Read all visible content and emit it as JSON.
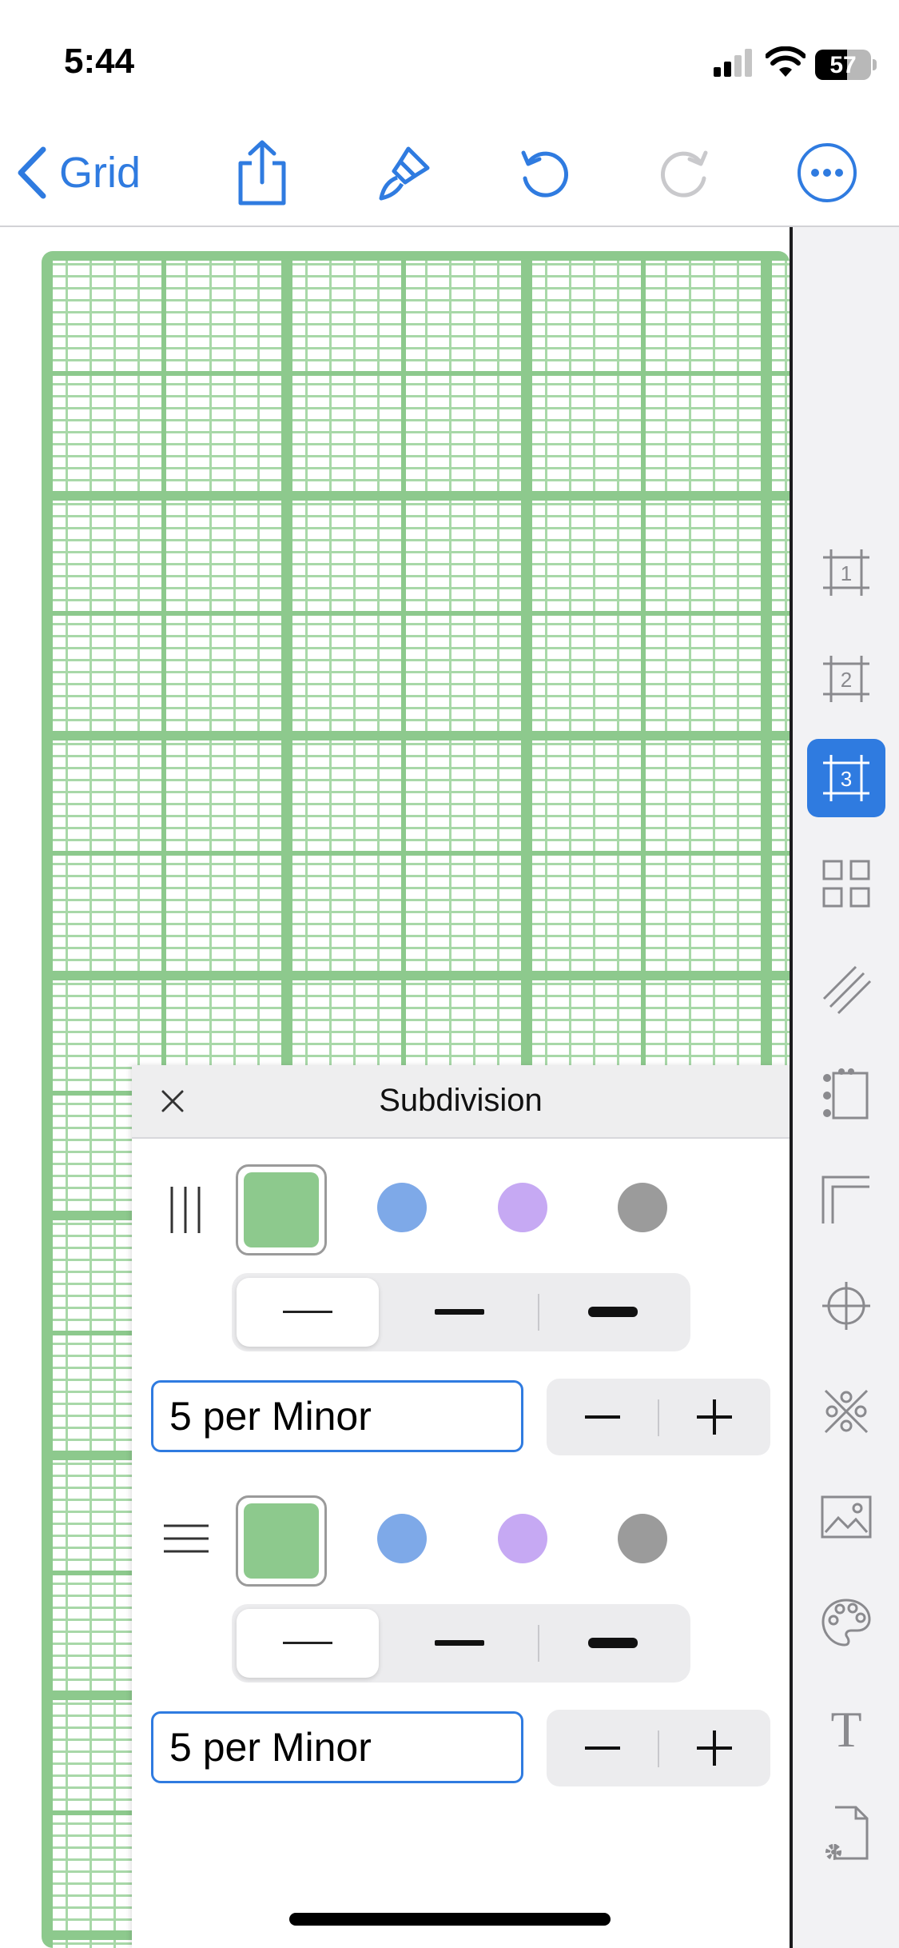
{
  "status_bar": {
    "time": "5:44",
    "battery": "57",
    "battery_level": 0.57
  },
  "nav": {
    "back_label": "Grid"
  },
  "sidebar": {
    "tools": [
      {
        "name": "layer-1",
        "label": "1"
      },
      {
        "name": "layer-2",
        "label": "2"
      },
      {
        "name": "layer-3",
        "label": "3",
        "active": true
      },
      {
        "name": "grid-tiles"
      },
      {
        "name": "diagonal-lines"
      },
      {
        "name": "dot-margin"
      },
      {
        "name": "corner-margins"
      },
      {
        "name": "crosshair"
      },
      {
        "name": "pattern"
      },
      {
        "name": "image"
      },
      {
        "name": "palette"
      },
      {
        "name": "text",
        "label": "T"
      },
      {
        "name": "page-settings"
      }
    ]
  },
  "panel": {
    "title": "Subdivision",
    "vertical": {
      "colors": [
        "#8dc98d",
        "#7ea9e8",
        "#c6a9f3",
        "#9b9b9b"
      ],
      "selected_color": "#8dc98d",
      "weights": [
        "thin",
        "medium",
        "thick"
      ],
      "selected_weight": "thin",
      "value": "5 per Minor"
    },
    "horizontal": {
      "colors": [
        "#8dc98d",
        "#7ea9e8",
        "#c6a9f3",
        "#9b9b9b"
      ],
      "selected_color": "#8dc98d",
      "weights": [
        "thin",
        "medium",
        "thick"
      ],
      "selected_weight": "thin",
      "value": "5 per Minor"
    }
  },
  "colors": {
    "accent": "#2f7be0",
    "grid_green": "#8dc98d"
  }
}
